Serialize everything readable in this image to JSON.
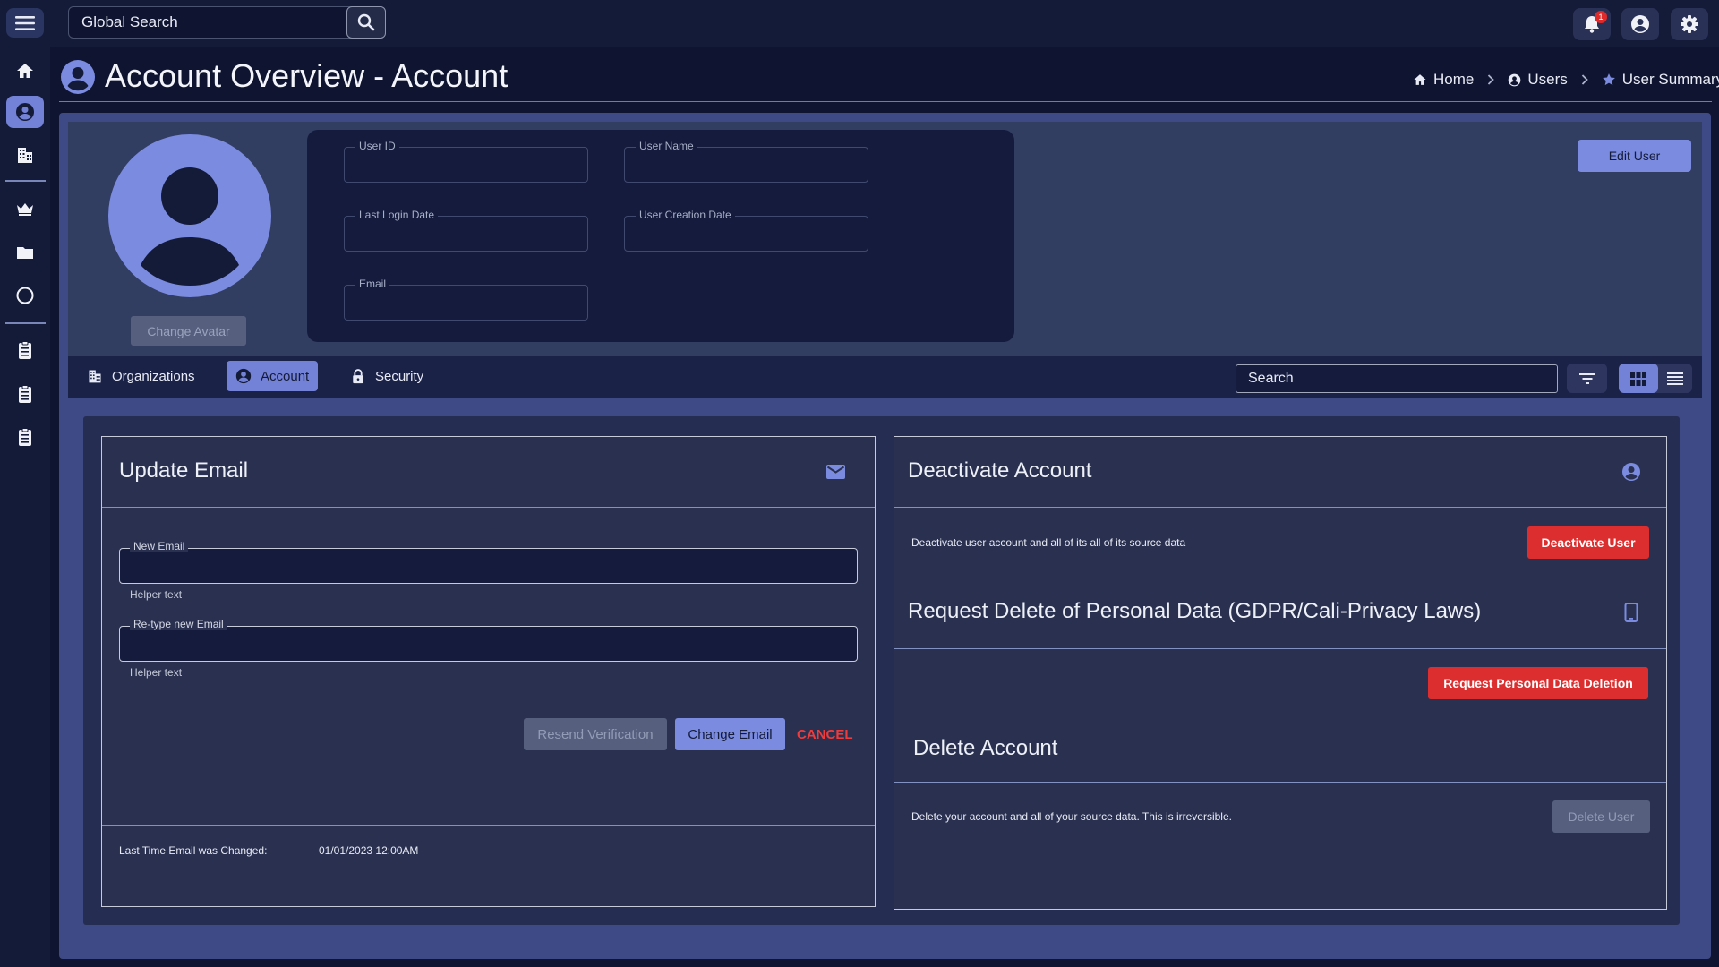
{
  "topbar": {
    "search_placeholder": "Global Search",
    "notification_count": "1",
    "icons": [
      "menu-icon",
      "search-icon",
      "bell-icon",
      "account-circle-icon",
      "gear-icon"
    ]
  },
  "sidebar": {
    "items": [
      {
        "icon": "home-icon"
      },
      {
        "icon": "account-circle-icon",
        "active": true
      },
      {
        "icon": "building-icon"
      },
      {
        "icon": "crown-icon"
      },
      {
        "icon": "folder-icon"
      },
      {
        "icon": "circle-icon"
      },
      {
        "icon": "clipboard-icon"
      },
      {
        "icon": "clipboard-icon"
      },
      {
        "icon": "clipboard-icon"
      }
    ]
  },
  "header": {
    "title": "Account Overview - Account",
    "breadcrumb": [
      {
        "label": "Home",
        "icon": "home-icon"
      },
      {
        "label": "Users",
        "icon": "account-circle-icon"
      },
      {
        "label": "User Summary",
        "icon": "star-icon"
      }
    ]
  },
  "profile": {
    "change_avatar_label": "Change Avatar",
    "edit_user_label": "Edit User",
    "fields": {
      "user_id": {
        "label": "User ID",
        "value": ""
      },
      "user_name": {
        "label": "User Name",
        "value": ""
      },
      "last_login": {
        "label": "Last Login Date",
        "value": ""
      },
      "creation_date": {
        "label": "User Creation Date",
        "value": ""
      },
      "email": {
        "label": "Email",
        "value": ""
      }
    }
  },
  "tabs": {
    "items": [
      {
        "label": "Organizations",
        "icon": "building-icon"
      },
      {
        "label": "Account",
        "icon": "account-circle-icon",
        "active": true
      },
      {
        "label": "Security",
        "icon": "lock-icon"
      }
    ],
    "search_placeholder": "Search"
  },
  "update_email": {
    "title": "Update Email",
    "new_email_label": "New Email",
    "new_email_value": "",
    "retype_label": "Re-type new Email",
    "retype_value": "",
    "helper_text": "Helper text",
    "resend_label": "Resend Verification",
    "change_label": "Change Email",
    "cancel_label": "CANCEL",
    "last_changed_label": "Last Time Email was Changed:",
    "last_changed_value": "01/01/2023  12:00AM"
  },
  "deactivate": {
    "title": "Deactivate Account",
    "description": "Deactivate user account and all of its all of its source data",
    "button_label": "Deactivate User"
  },
  "gdpr": {
    "title": "Request Delete of Personal Data (GDPR/Cali-Privacy Laws)",
    "button_label": "Request  Personal Data Deletion"
  },
  "delete_account": {
    "title": "Delete Account",
    "description": "Delete your account and all of your source data. This is irreversible.",
    "button_label": "Delete User"
  },
  "colors": {
    "background": "#0f1530",
    "bar": "#141b39",
    "accent": "#7382d6",
    "danger": "#dc2e2e",
    "disabled": "#56607e"
  }
}
